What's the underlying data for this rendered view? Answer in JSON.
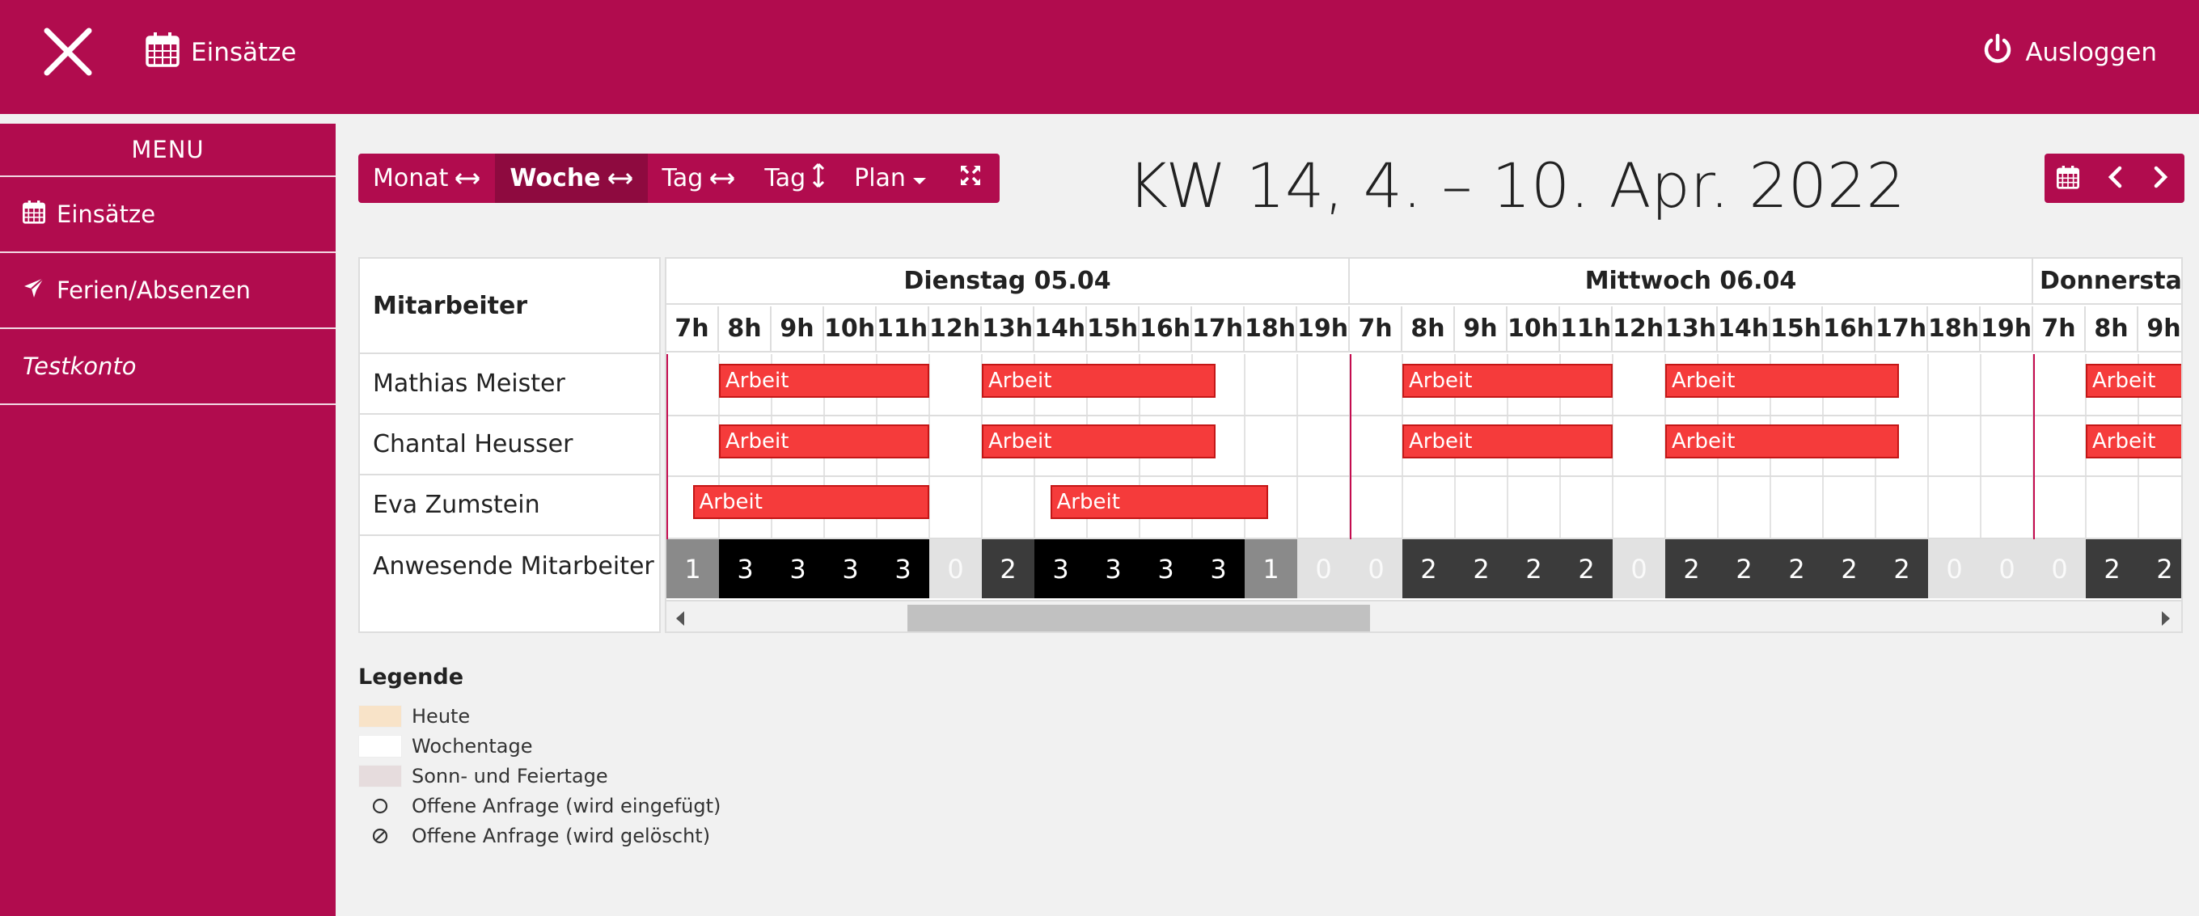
{
  "topbar": {
    "nav_label": "Einsätze",
    "logout_label": "Ausloggen"
  },
  "sidebar": {
    "title": "MENU",
    "items": [
      {
        "label": "Einsätze",
        "icon": "calendar-icon"
      },
      {
        "label": "Ferien/Absenzen",
        "icon": "plane-icon"
      },
      {
        "label": "Testkonto",
        "icon": ""
      }
    ]
  },
  "toolbar": {
    "month": "Monat",
    "week": "Woche",
    "day_h": "Tag",
    "day_v": "Tag",
    "plan": "Plan"
  },
  "week_title": "KW 14, 4. – 10. Apr. 2022",
  "grid": {
    "header_label": "Mitarbeiter",
    "days": [
      "Dienstag 05.04",
      "Mittwoch 06.04",
      "Donnerstag"
    ],
    "hours": [
      "7h",
      "8h",
      "9h",
      "10h",
      "11h",
      "12h",
      "13h",
      "14h",
      "15h",
      "16h",
      "17h",
      "18h",
      "19h",
      "7h",
      "8h",
      "9h",
      "10h",
      "11h",
      "12h",
      "13h",
      "14h",
      "15h",
      "16h",
      "17h",
      "18h",
      "19h",
      "7h",
      "8h",
      "9h"
    ],
    "employees": [
      "Mathias Meister",
      "Chantal Heusser",
      "Eva Zumstein"
    ],
    "summary_label": "Anwesende Mitarbeiter",
    "bar_label": "Arbeit",
    "counts": [
      1,
      3,
      3,
      3,
      3,
      0,
      2,
      3,
      3,
      3,
      3,
      1,
      0,
      0,
      2,
      2,
      2,
      2,
      0,
      2,
      2,
      2,
      2,
      2,
      0,
      0,
      0,
      2,
      2
    ]
  },
  "legend": {
    "title": "Legende",
    "items": [
      {
        "label": "Heute",
        "color": "#f8e3c8"
      },
      {
        "label": "Wochentage",
        "color": "#ffffff"
      },
      {
        "label": "Sonn- und Feiertage",
        "color": "#e6dcdd"
      },
      {
        "label": "Offene Anfrage (wird eingefügt)",
        "icon": "circle-icon"
      },
      {
        "label": "Offene Anfrage (wird gelöscht)",
        "icon": "circle-slash-icon"
      }
    ]
  },
  "colors": {
    "brand": "#b10c4e",
    "bar": "#f53b3b"
  }
}
